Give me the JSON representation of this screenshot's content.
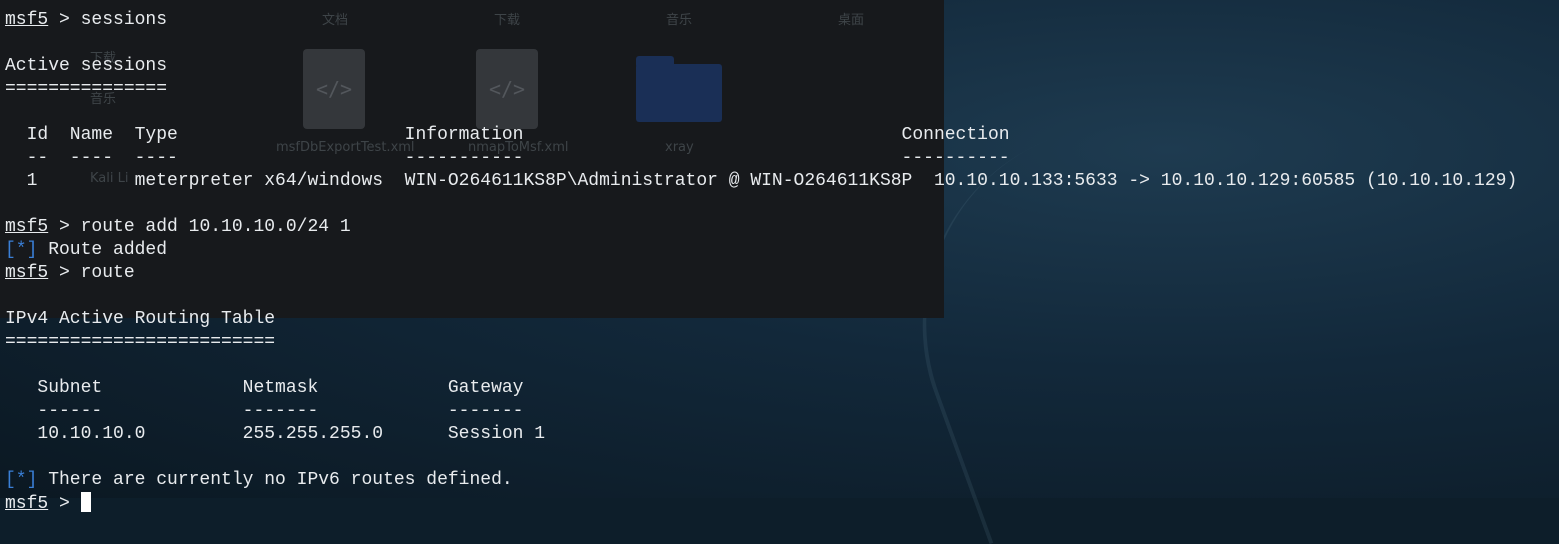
{
  "background_window": {
    "places": [
      "文档",
      "下载",
      "音乐",
      "桌面"
    ],
    "sidebar": [
      "下载",
      "音乐",
      "Kali Li"
    ],
    "files": [
      {
        "name": "msfDbExportTest.xml",
        "kind": "xml-file"
      },
      {
        "name": "nmapToMsf.xml",
        "kind": "xml-file"
      },
      {
        "name": "xray",
        "kind": "folder"
      }
    ]
  },
  "terminal": {
    "prompt": "msf5",
    "lines": [
      {
        "prompt": "msf5",
        "text": " > sessions"
      },
      {
        "text": ""
      },
      {
        "text": "Active sessions"
      },
      {
        "text": "==============="
      },
      {
        "text": ""
      },
      {
        "text": "  Id  Name  Type                     Information                                   Connection"
      },
      {
        "text": "  --  ----  ----                     -----------                                   ----------"
      },
      {
        "text": "  1         meterpreter x64/windows  WIN-O264611KS8P\\Administrator @ WIN-O264611KS8P  10.10.10.133:5633 -> 10.10.10.129:60585 (10.10.10.129)"
      },
      {
        "text": ""
      },
      {
        "prompt": "msf5",
        "text": " > route add 10.10.10.0/24 1"
      },
      {
        "marker": "[*]",
        "text": " Route added"
      },
      {
        "prompt": "msf5",
        "text": " > route"
      },
      {
        "text": ""
      },
      {
        "text": "IPv4 Active Routing Table"
      },
      {
        "text": "========================="
      },
      {
        "text": ""
      },
      {
        "text": "   Subnet             Netmask            Gateway"
      },
      {
        "text": "   ------             -------            -------"
      },
      {
        "text": "   10.10.10.0         255.255.255.0      Session 1"
      },
      {
        "text": ""
      },
      {
        "marker": "[*]",
        "text": " There are currently no IPv6 routes defined."
      },
      {
        "prompt": "msf5",
        "text": " > ",
        "cursor": true
      }
    ]
  },
  "colors": {
    "text": "#e8ebee",
    "marker": "#3a7fd6",
    "background": "#0d1e2a"
  }
}
